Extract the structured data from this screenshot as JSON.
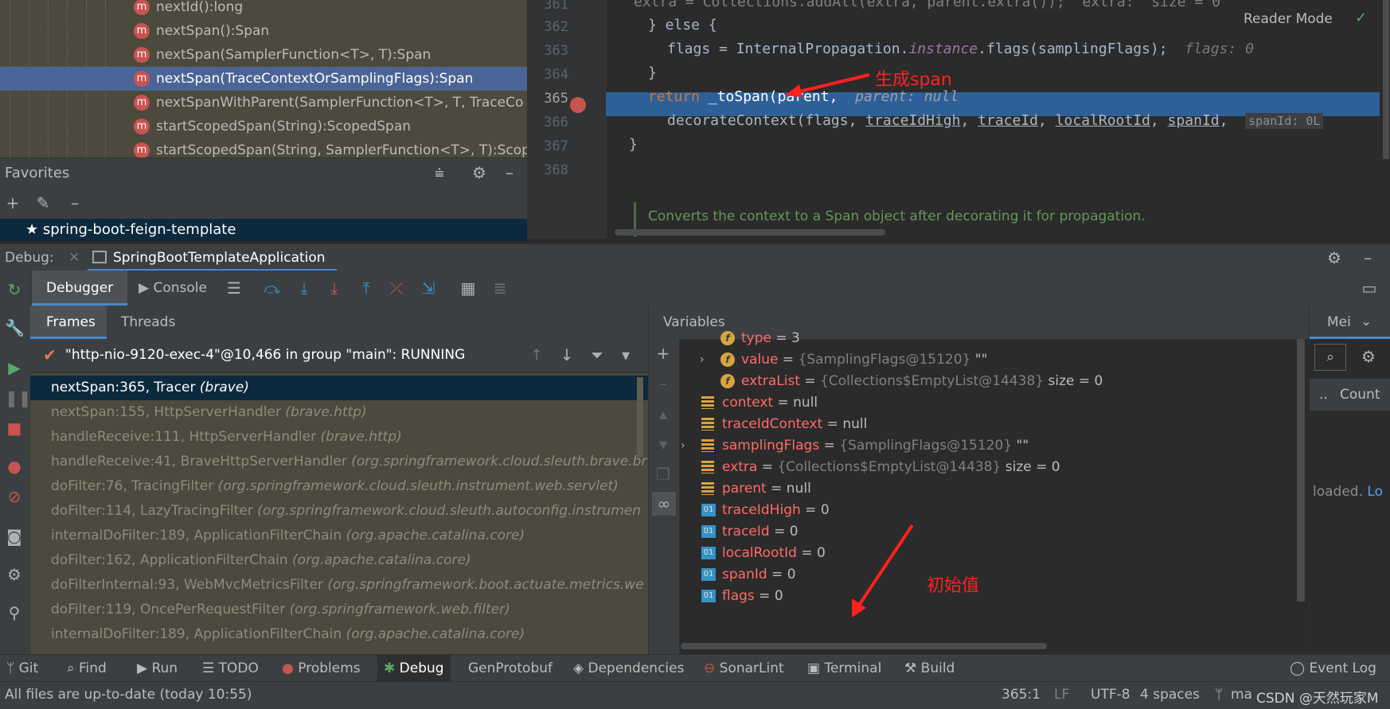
{
  "structure": {
    "items": [
      {
        "badge": "m",
        "label": "nextId():long"
      },
      {
        "badge": "m",
        "label": "nextSpan():Span"
      },
      {
        "badge": "m",
        "label": "nextSpan(SamplerFunction<T>, T):Span"
      },
      {
        "badge": "m",
        "label": "nextSpan(TraceContextOrSamplingFlags):Span"
      },
      {
        "badge": "m",
        "label": "nextSpanWithParent(SamplerFunction<T>, T, TraceCo"
      },
      {
        "badge": "m",
        "label": "startScopedSpan(String):ScopedSpan"
      },
      {
        "badge": "m",
        "label": "startScopedSpan(String, SamplerFunction<T>, T):Scop"
      }
    ]
  },
  "favorites": {
    "title": "Favorites",
    "item": "spring-boot-feign-template"
  },
  "editor": {
    "reader_mode": "Reader Mode",
    "lines": [
      {
        "num": "361",
        "text": "extra = Collections.addAll(extra, parent.extra());  extra:  size = 0"
      },
      {
        "num": "362",
        "text": "} else {"
      },
      {
        "num": "363",
        "a": "flags = InternalPropagation.",
        "b": "instance",
        "c": ".flags(samplingFlags);",
        "hint": "flags: 0"
      },
      {
        "num": "364",
        "text": "}"
      },
      {
        "num": "365",
        "kw": "return",
        "text": " _toSpan(parent,",
        "hint": "parent: null"
      },
      {
        "num": "366",
        "a": "decorateContext(flags, ",
        "u1": "traceIdHigh",
        "u2": "traceId",
        "u3": "localRootId",
        "u4": "spanId",
        "hint": "spanId: 0L"
      },
      {
        "num": "367",
        "text": "}"
      },
      {
        "num": "368",
        "text": ""
      }
    ],
    "doc_comment": "Converts the context to a Span object after decorating it for propagation.",
    "annotation": "生成span"
  },
  "debug": {
    "label": "Debug:",
    "session_tab": "SpringBootTemplateApplication",
    "tabs": {
      "debugger": "Debugger",
      "console": "Console"
    },
    "frames_tabs": {
      "frames": "Frames",
      "threads": "Threads"
    },
    "thread": "\"http-nio-9120-exec-4\"@10,466 in group \"main\": RUNNING",
    "frames": [
      {
        "method": "nextSpan:365, Tracer",
        "pkg": "(brave)"
      },
      {
        "method": "nextSpan:155, HttpServerHandler",
        "pkg": "(brave.http)"
      },
      {
        "method": "handleReceive:111, HttpServerHandler",
        "pkg": "(brave.http)"
      },
      {
        "method": "handleReceive:41, BraveHttpServerHandler",
        "pkg": "(org.springframework.cloud.sleuth.brave.br"
      },
      {
        "method": "doFilter:76, TracingFilter",
        "pkg": "(org.springframework.cloud.sleuth.instrument.web.servlet)"
      },
      {
        "method": "doFilter:114, LazyTracingFilter",
        "pkg": "(org.springframework.cloud.sleuth.autoconfig.instrumen"
      },
      {
        "method": "internalDoFilter:189, ApplicationFilterChain",
        "pkg": "(org.apache.catalina.core)"
      },
      {
        "method": "doFilter:162, ApplicationFilterChain",
        "pkg": "(org.apache.catalina.core)"
      },
      {
        "method": "doFilterInternal:93, WebMvcMetricsFilter",
        "pkg": "(org.springframework.boot.actuate.metrics.we"
      },
      {
        "method": "doFilter:119, OncePerRequestFilter",
        "pkg": "(org.springframework.web.filter)"
      },
      {
        "method": "internalDoFilter:189, ApplicationFilterChain",
        "pkg": "(org.apache.catalina.core)"
      }
    ],
    "variables_title": "Variables",
    "variables": [
      {
        "icon": "field",
        "name": "type",
        "eq": " = ",
        "value": "3",
        "ref": "",
        "extra": "",
        "indent": 2,
        "expand": false
      },
      {
        "icon": "field",
        "name": "value",
        "eq": " = ",
        "value": "",
        "ref": "{SamplingFlags@15120}",
        "extra": " \"\"",
        "indent": 2,
        "expand": true
      },
      {
        "icon": "field",
        "name": "extraList",
        "eq": " = ",
        "value": "",
        "ref": "{Collections$EmptyList@14438}",
        "extra": "  size = 0",
        "indent": 2,
        "expand": false
      },
      {
        "icon": "list",
        "name": "context",
        "eq": " = ",
        "value": "null",
        "ref": "",
        "extra": "",
        "indent": 1,
        "expand": false
      },
      {
        "icon": "list",
        "name": "traceIdContext",
        "eq": " = ",
        "value": "null",
        "ref": "",
        "extra": "",
        "indent": 1,
        "expand": false
      },
      {
        "icon": "list",
        "name": "samplingFlags",
        "eq": " = ",
        "value": "",
        "ref": "{SamplingFlags@15120}",
        "extra": " \"\"",
        "indent": 1,
        "expand": true
      },
      {
        "icon": "list",
        "name": "extra",
        "eq": " = ",
        "value": "",
        "ref": "{Collections$EmptyList@14438}",
        "extra": "  size = 0",
        "indent": 1,
        "expand": false
      },
      {
        "icon": "list",
        "name": "parent",
        "eq": " = ",
        "value": "null",
        "ref": "",
        "extra": "",
        "indent": 1,
        "expand": false
      },
      {
        "icon": "prim",
        "name": "traceIdHigh",
        "eq": " = ",
        "value": "0",
        "ref": "",
        "extra": "",
        "indent": 1,
        "expand": false
      },
      {
        "icon": "prim",
        "name": "traceId",
        "eq": " = ",
        "value": "0",
        "ref": "",
        "extra": "",
        "indent": 1,
        "expand": false
      },
      {
        "icon": "prim",
        "name": "localRootId",
        "eq": " = ",
        "value": "0",
        "ref": "",
        "extra": "",
        "indent": 1,
        "expand": false
      },
      {
        "icon": "prim",
        "name": "spanId",
        "eq": " = ",
        "value": "0",
        "ref": "",
        "extra": "",
        "indent": 1,
        "expand": false
      },
      {
        "icon": "prim",
        "name": "flags",
        "eq": " = ",
        "value": "0",
        "ref": "",
        "extra": "",
        "indent": 1,
        "expand": false
      }
    ],
    "annotation": "初始值",
    "memory": {
      "tab": "Mei",
      "count": "Count",
      "dots": "..",
      "loaded": "loaded.",
      "link": "Lo"
    }
  },
  "tool_tabs": [
    {
      "label": "Git",
      "icon": "branch-icon"
    },
    {
      "label": "Find",
      "icon": "search-icon"
    },
    {
      "label": "Run",
      "icon": "play-icon"
    },
    {
      "label": "TODO",
      "icon": "list-icon"
    },
    {
      "label": "Problems",
      "icon": "error-icon"
    },
    {
      "label": "Debug",
      "icon": "bug-icon"
    },
    {
      "label": "GenProtobuf",
      "icon": ""
    },
    {
      "label": "Dependencies",
      "icon": "layers-icon"
    },
    {
      "label": "SonarLint",
      "icon": "sonar-icon"
    },
    {
      "label": "Terminal",
      "icon": "terminal-icon"
    },
    {
      "label": "Build",
      "icon": "hammer-icon"
    },
    {
      "label": "Event Log",
      "icon": "speech-icon"
    }
  ],
  "status": {
    "message": "All files are up-to-date (today 10:55)",
    "position": "365:1",
    "line_sep": "LF",
    "encoding": "UTF-8",
    "indent": "4 spaces",
    "branch": "ma",
    "watermark": "CSDN @天然玩家M"
  }
}
